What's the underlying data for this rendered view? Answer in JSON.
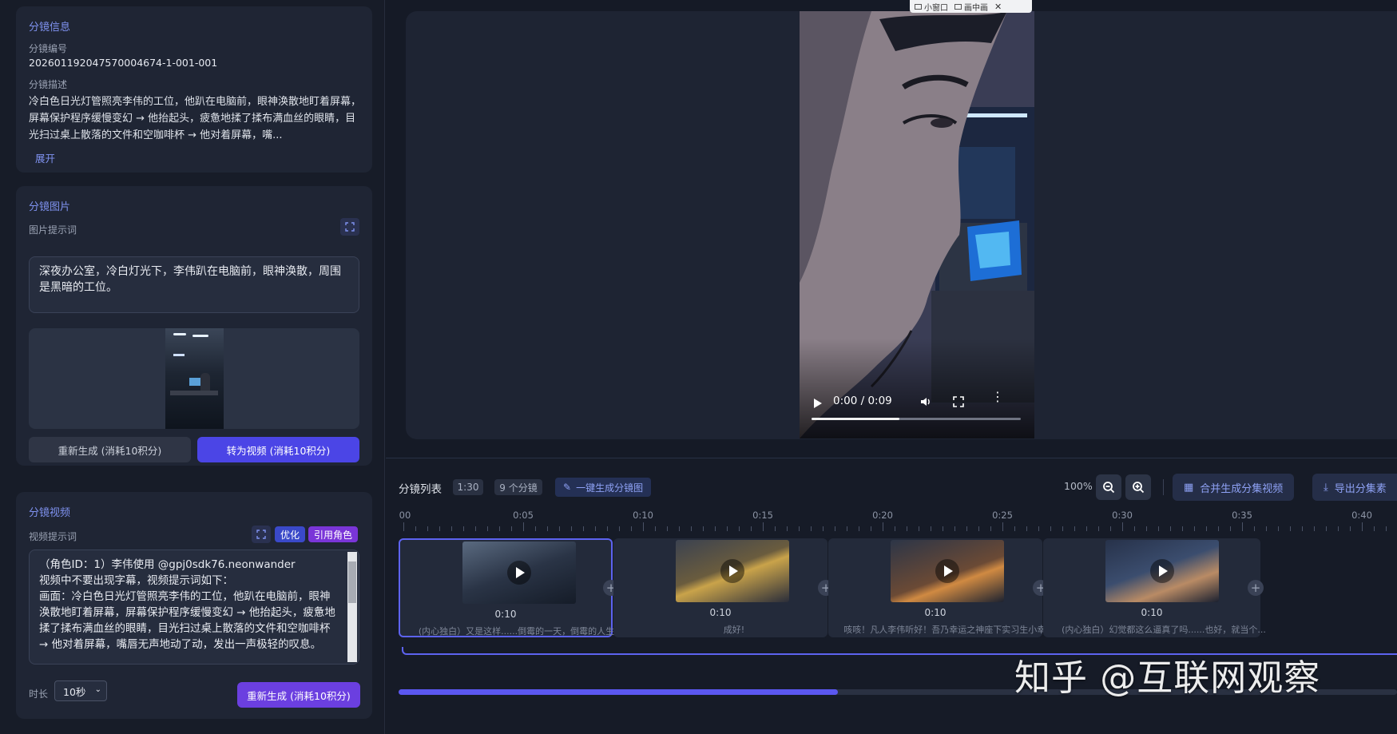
{
  "shot_info": {
    "title": "分镜信息",
    "id_label": "分镜编号",
    "id_value": "20260119204757000467​4-1-001-001",
    "desc_label": "分镜描述",
    "desc_text": "冷白色日光灯管照亮李伟的工位，他趴在电脑前，眼神涣散地盯着屏幕，屏幕保护程序缓慢变幻 → 他抬起头，疲惫地揉了揉布满血丝的眼睛，目光扫过桌上散落的文件和空咖啡杯 → 他对着屏幕，嘴...",
    "expand_label": "展开"
  },
  "shot_image": {
    "title": "分镜图片",
    "prompt_label": "图片提示词",
    "prompt_text": "深夜办公室，冷白灯光下，李伟趴在电脑前，眼神涣散，周围是黑暗的工位。",
    "regen_label": "重新生成 (消耗10积分)",
    "to_video_label": "转为视频 (消耗10积分)"
  },
  "shot_video": {
    "title": "分镜视频",
    "prompt_label": "视频提示词",
    "optimize_label": "优化",
    "ref_role_label": "引用角色",
    "prompt_text": "（角色ID：1）李伟使用 @gpj0sdk76.neonwander\n视频中不要出现字幕，视频提示词如下：\n画面：冷白色日光灯管照亮李伟的工位，他趴在电脑前，眼神涣散地盯着屏幕，屏幕保护程序缓慢变幻 → 他抬起头，疲惫地揉了揉布满血丝的眼睛，目光扫过桌上散落的文件和空咖啡杯 → 他对着屏幕，嘴唇无声地动了动，发出一声极轻的叹息。",
    "duration_label": "时长",
    "duration_value": "10秒",
    "regen_label": "重新生成 (消耗10积分)"
  },
  "pip": {
    "mini_label": "小窗口",
    "pip_label": "画中画"
  },
  "player": {
    "time": "0:00 / 0:09",
    "progress": 0.42
  },
  "timeline": {
    "title": "分镜列表",
    "total_duration": "1:30",
    "count": "9 个分镜",
    "gen_all_label": "一键生成分镜图",
    "zoom": "100%",
    "merge_label": "合并生成分集视频",
    "export_label": "导出分集素",
    "ruler": [
      "00",
      "0:05",
      "0:10",
      "0:15",
      "0:20",
      "0:25",
      "0:30",
      "0:35",
      "0:40"
    ],
    "clips": [
      {
        "duration": "0:10",
        "caption": "(内心独白）又是这样......倒霉的一天，倒霉的人生。"
      },
      {
        "duration": "0:10",
        "caption": "成好!"
      },
      {
        "duration": "0:10",
        "caption": "咳咳！凡人李伟听好！吾乃幸运之神座下实习生小幸..."
      },
      {
        "duration": "0:10",
        "caption": "(内心独白）幻觉都这么逼真了吗......也好，就当个..."
      }
    ],
    "progress": 0.44
  },
  "watermark": "知乎 @互联网观察"
}
